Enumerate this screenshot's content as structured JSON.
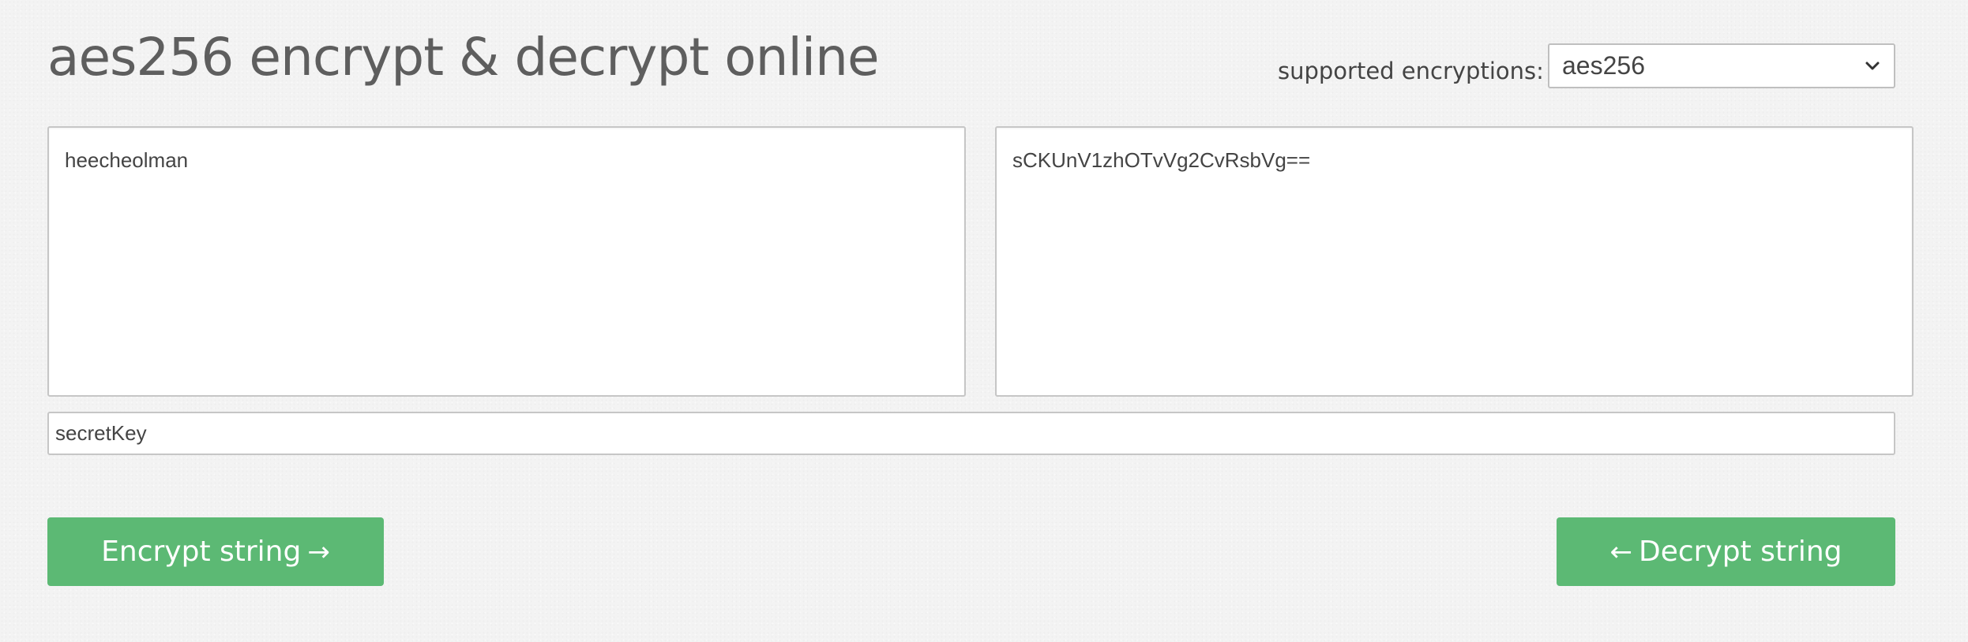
{
  "header": {
    "title": "aes256 encrypt & decrypt online"
  },
  "encryption": {
    "label": "supported encryptions:",
    "selected": "aes256",
    "chevron_icon": "chevron-down-icon"
  },
  "plain_text": {
    "value": "heecheolman"
  },
  "cipher_text": {
    "value": "sCKUnV1zhOTvVg2CvRsbVg=="
  },
  "secret_key": {
    "value": "secretKey"
  },
  "actions": {
    "encrypt_label": "Encrypt string",
    "encrypt_arrow": "→",
    "decrypt_label": "Decrypt string",
    "decrypt_arrow": "←"
  },
  "colors": {
    "button_green": "#5cb974",
    "background": "#f3f3f3",
    "title_text": "#5e5e5e"
  }
}
